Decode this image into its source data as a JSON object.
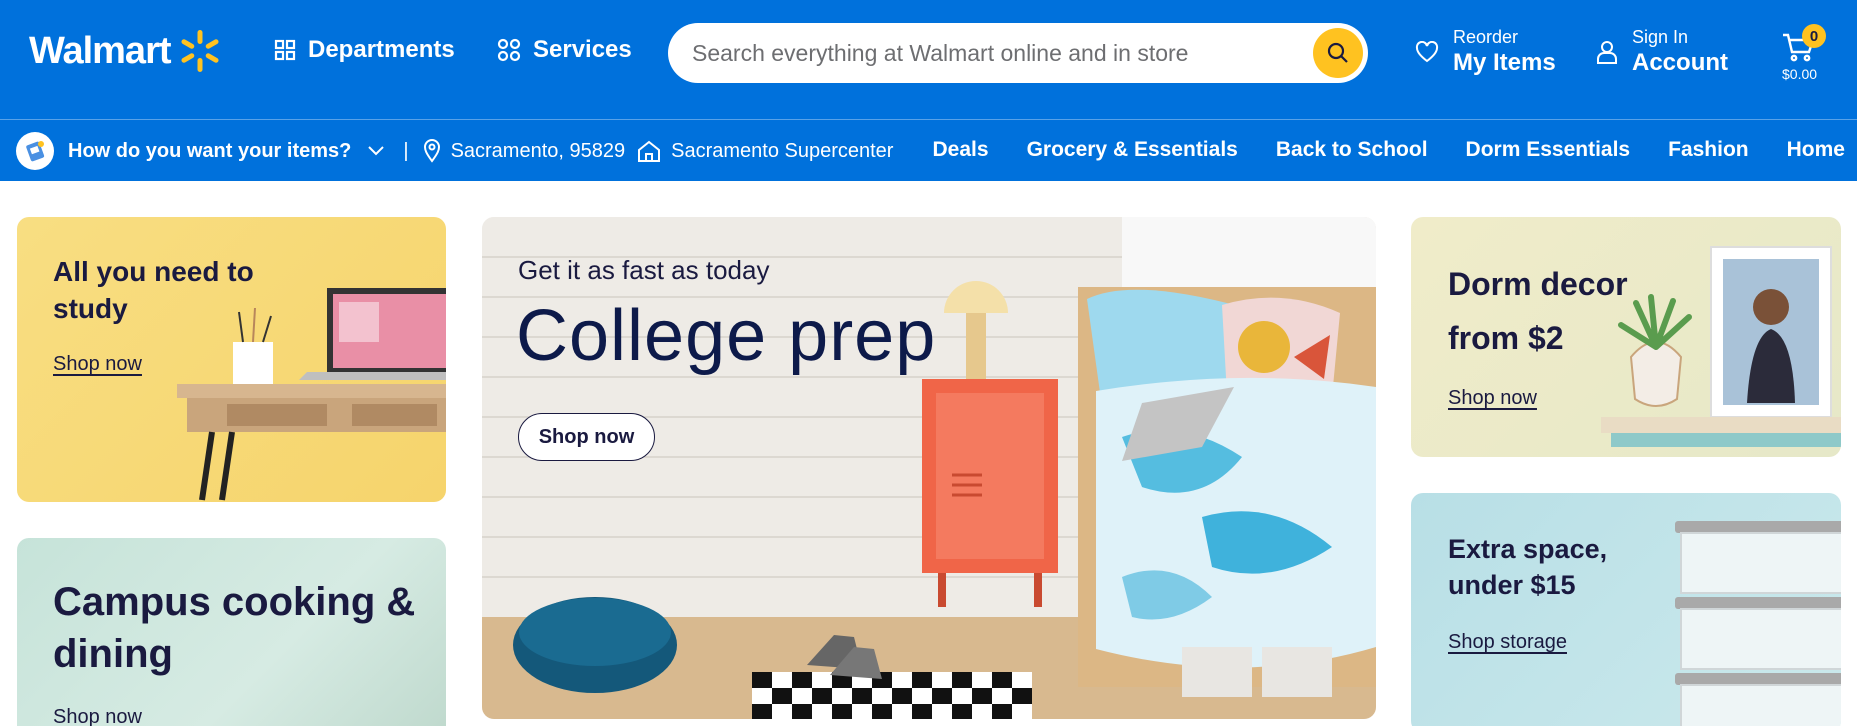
{
  "header": {
    "logo_text": "Walmart",
    "departments_label": "Departments",
    "services_label": "Services",
    "search_placeholder": "Search everything at Walmart online and in store",
    "reorder_small": "Reorder",
    "reorder_big": "My Items",
    "signin_small": "Sign In",
    "signin_big": "Account",
    "cart_count": "0",
    "cart_total": "$0.00",
    "colors": {
      "brand_blue": "#0071dc",
      "spark_yellow": "#ffc220"
    }
  },
  "subbar": {
    "fulfillment_question": "How do you want your items?",
    "separator": "|",
    "location": "Sacramento, 95829",
    "store": "Sacramento Supercenter",
    "nav": [
      "Deals",
      "Grocery & Essentials",
      "Back to School",
      "Dorm Essentials",
      "Fashion",
      "Home"
    ]
  },
  "cards": {
    "study": {
      "title": "All you need to study",
      "cta": "Shop now"
    },
    "cooking": {
      "title": "Campus cooking & dining",
      "cta": "Shop now"
    },
    "hero": {
      "subtitle": "Get it as fast as today",
      "title": "College prep",
      "cta": "Shop now"
    },
    "dorm": {
      "title": "Dorm decor from $2",
      "cta": "Shop now"
    },
    "storage": {
      "title": "Extra space, under $15",
      "cta": "Shop storage"
    }
  }
}
